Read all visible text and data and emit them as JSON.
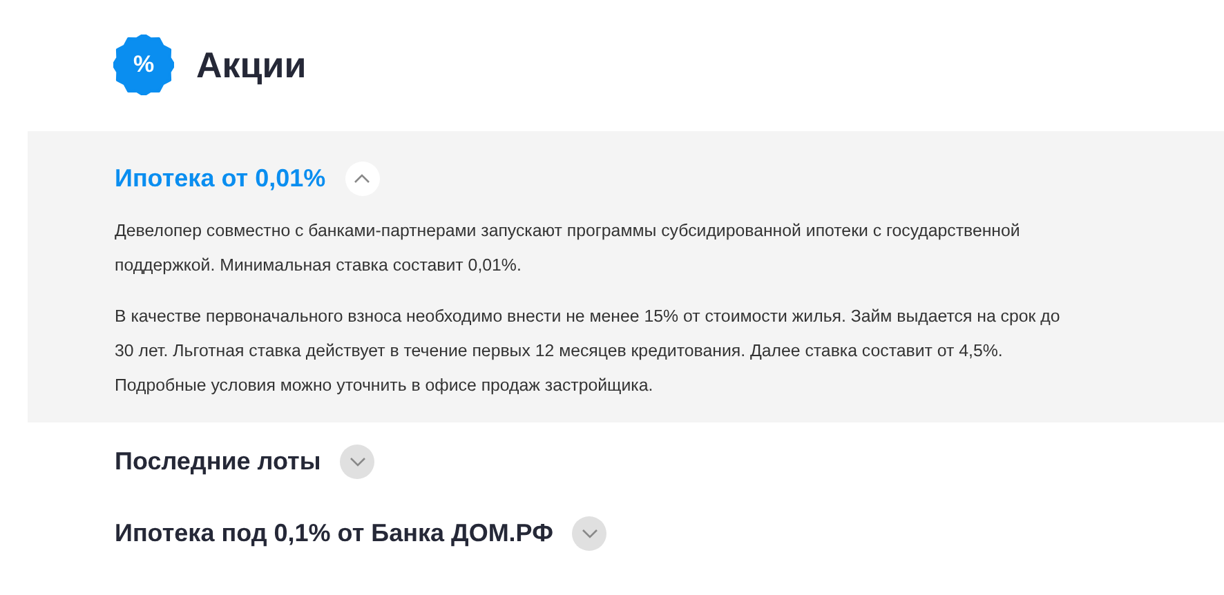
{
  "header": {
    "badge": "%",
    "title": "Акции"
  },
  "sections": [
    {
      "title": "Ипотека от 0,01%",
      "expanded": true,
      "paragraphs": [
        "Девелопер совместно с банками-партнерами запускают программы субсидированной ипотеки с государственной поддержкой. Минимальная ставка составит 0,01%.",
        "В качестве первоначального взноса необходимо внести не менее 15% от стоимости жилья. Займ выдается на срок до 30 лет. Льготная ставка действует в течение первых 12 месяцев кредитования. Далее ставка составит от 4,5%. Подробные условия можно уточнить в офисе продаж застройщика."
      ]
    },
    {
      "title": "Последние лоты",
      "expanded": false
    },
    {
      "title": "Ипотека под 0,1% от Банка ДОМ.РФ",
      "expanded": false
    }
  ]
}
